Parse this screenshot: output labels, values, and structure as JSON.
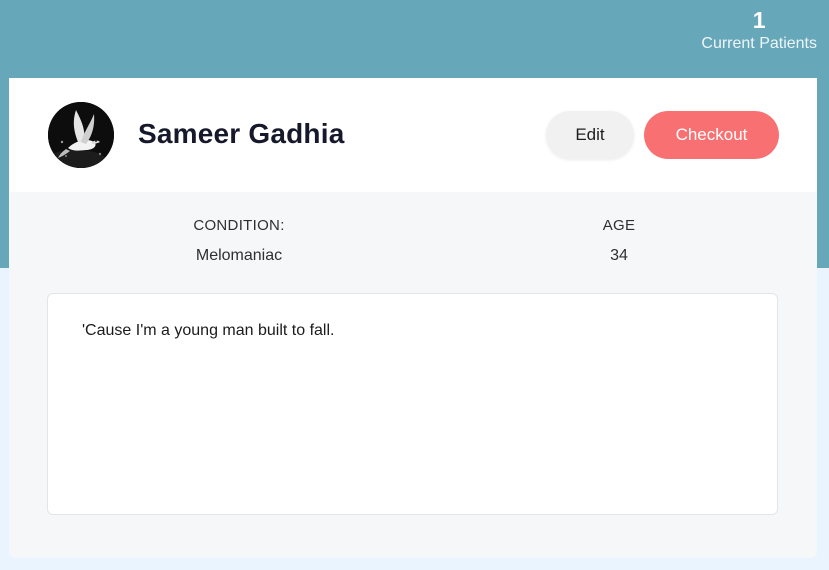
{
  "header": {
    "patients_count": "1",
    "patients_label": "Current Patients"
  },
  "patient": {
    "avatar_icon": "dove-photo-icon",
    "name": "Sameer Gadhia",
    "actions": {
      "edit_label": "Edit",
      "checkout_label": "Checkout"
    },
    "condition": {
      "label": "CONDITION:",
      "value": "Melomaniac"
    },
    "age": {
      "label": "AGE",
      "value": "34"
    },
    "notes": "'Cause I'm a young man built to fall."
  },
  "colors": {
    "header_band": "#66a7b9",
    "checkout_button": "#f87071",
    "edit_button": "#f1f1f1",
    "page_background": "#eaf4fe",
    "card_background": "#f5f7f9"
  }
}
